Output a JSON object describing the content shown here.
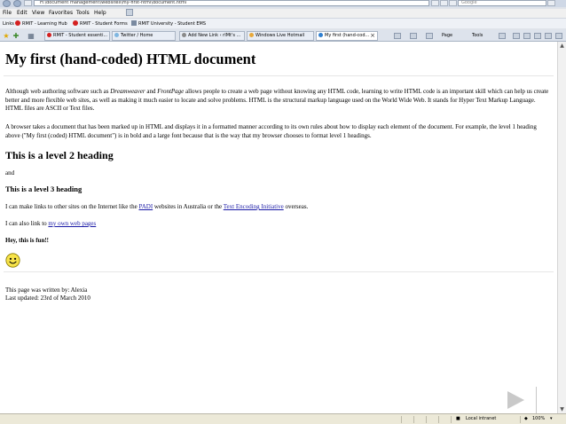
{
  "browser": {
    "address": "H:\\document management\\websites\\my-first-html\\document.html",
    "search_placeholder": "Google",
    "menu": [
      "File",
      "Edit",
      "View",
      "Favorites",
      "Tools",
      "Help"
    ],
    "links_label": "Links",
    "links": [
      "RMIT - Learning Hub",
      "RMIT - Student Forms",
      "RMIT University - Student EMS"
    ],
    "tabs": [
      {
        "label": "RMIT - Student essenti...",
        "active": false
      },
      {
        "label": "Twitter / Home",
        "active": false
      },
      {
        "label": "Add New Link ‹ rIMt's ...",
        "active": false
      },
      {
        "label": "Windows Live Hotmail",
        "active": false
      },
      {
        "label": "My first (hand-cod...",
        "active": true
      }
    ],
    "commands": [
      "Page",
      "Tools"
    ],
    "status_zone": "Local intranet",
    "zoom": "100%"
  },
  "page": {
    "h1": "My first (hand-coded) HTML document",
    "intro": {
      "t1": "Although web authoring software such as ",
      "em1": "Dreamweaver",
      "t2": " and ",
      "em2": "FrontPage",
      "t3": " allows people to create a web page without knowing any HTML code, learning to write HTML code is an important skill which can help us create better and more flexible web sites, as well as making it much easier to locate and solve problems. HTML is the structural markup language used on the World Wide Web. It stands for Hyper Text Markup Language. HTML files are ASCII or Text files."
    },
    "para2": "A browser takes a document that has been marked up in HTML and displays it in a formatted manner according to its own rules about how to display each element of the document. For example, the level 1 heading above (\"My first (coded) HTML document\") is in bold and a large font because that is the way that my browser chooses to format level 1 headings.",
    "h2": "This is a level 2 heading",
    "and_text": "and",
    "h3": "This is a level 3 heading",
    "links_para": {
      "t1": "I can make links to other sites on the Internet like the ",
      "link1": "PADI",
      "t2": " websites in Australia or the ",
      "link2": "Text Encoding Initiative",
      "t3": " overseas."
    },
    "own_link_para": {
      "t1": "I can also link to ",
      "link": "my own web pages"
    },
    "fun": "Hey, this is fun!!",
    "footer_written": "This page was written by: Alexia",
    "footer_updated": "Last updated: 23rd of March 2010"
  }
}
